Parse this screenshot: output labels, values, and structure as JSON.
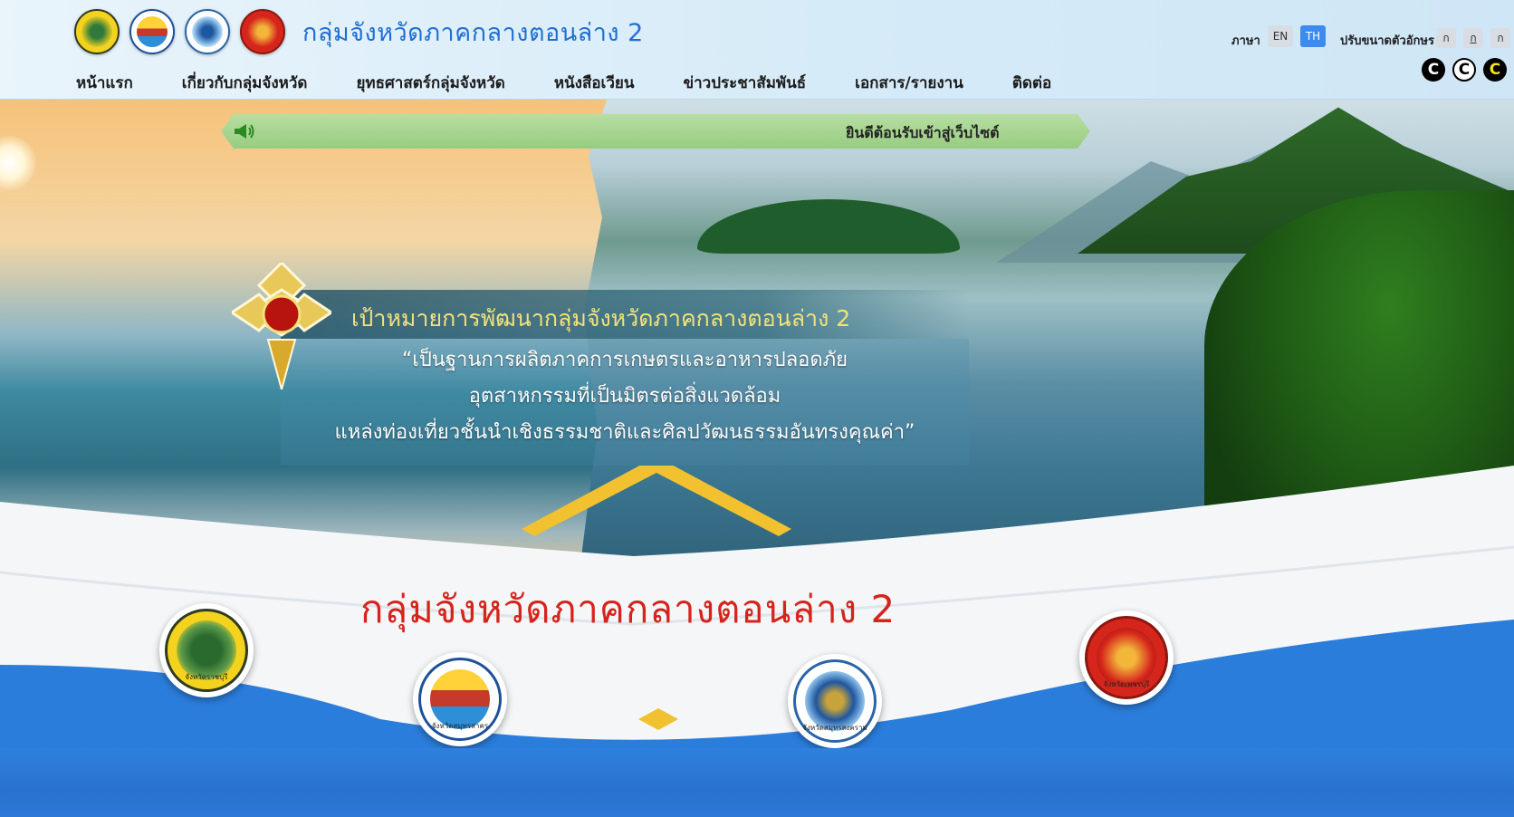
{
  "header": {
    "title": "กลุ่มจังหวัดภาคกลางตอนล่าง 2",
    "seals": [
      "province-seal-ratchaburi",
      "province-seal-samut-sakhon",
      "province-seal-samut-songkhram",
      "province-seal-phetchaburi"
    ]
  },
  "toolbar": {
    "language_label": "ภาษา",
    "lang_en": "EN",
    "lang_th": "TH",
    "active_language": "TH",
    "font_size_label": "ปรับขนาดตัวอักษร",
    "font_small": "ก",
    "font_medium": "ก",
    "font_large": "ก",
    "contrast_normal": "C",
    "contrast_white": "C",
    "contrast_yellow": "C"
  },
  "nav": {
    "items": [
      {
        "label": "หน้าแรก"
      },
      {
        "label": "เกี่ยวกับกลุ่มจังหวัด"
      },
      {
        "label": "ยุทธศาสตร์กลุ่มจังหวัด"
      },
      {
        "label": "หนังสือเวียน"
      },
      {
        "label": "ข่าวประชาสัมพันธ์"
      },
      {
        "label": "เอกสาร/รายงาน"
      },
      {
        "label": "ติดต่อ"
      }
    ]
  },
  "banner": {
    "ticker_text": "ยินดีต้อนรับเข้าสู่เว็บไซต์",
    "goal_title": "เป้าหมายการพัฒนากลุ่มจังหวัดภาคกลางตอนล่าง 2",
    "vision_lines": [
      "“เป็นฐานการผลิตภาคการเกษตรและอาหารปลอดภัย",
      "อุตสาหกรรมที่เป็นมิตรต่อสิ่งแวดล้อม",
      "แหล่งท่องเที่ยวชั้นนำเชิงธรรมชาติและศิลปวัฒนธรรมอันทรงคุณค่า”"
    ],
    "main_heading": "กลุ่มจังหวัดภาคกลางตอนล่าง 2"
  },
  "provinces": [
    {
      "caption": "จังหวัดราชบุรี",
      "icon": "ratchaburi-seal-icon"
    },
    {
      "caption": "จังหวัดสมุทรสาคร",
      "icon": "samut-sakhon-seal-icon"
    },
    {
      "caption": "จังหวัดสมุทรสงคราม",
      "icon": "samut-songkhram-seal-icon"
    },
    {
      "caption": "จังหวัดเพชรบุรี",
      "icon": "phetchaburi-seal-icon"
    }
  ],
  "colors": {
    "title_blue": "#1f6ed4",
    "heading_red": "#d6231c",
    "goal_gold": "#f3e27a",
    "active_lang": "#3d8af0",
    "ticker_green": "#98cc82",
    "band_blue": "#2b78d6"
  }
}
